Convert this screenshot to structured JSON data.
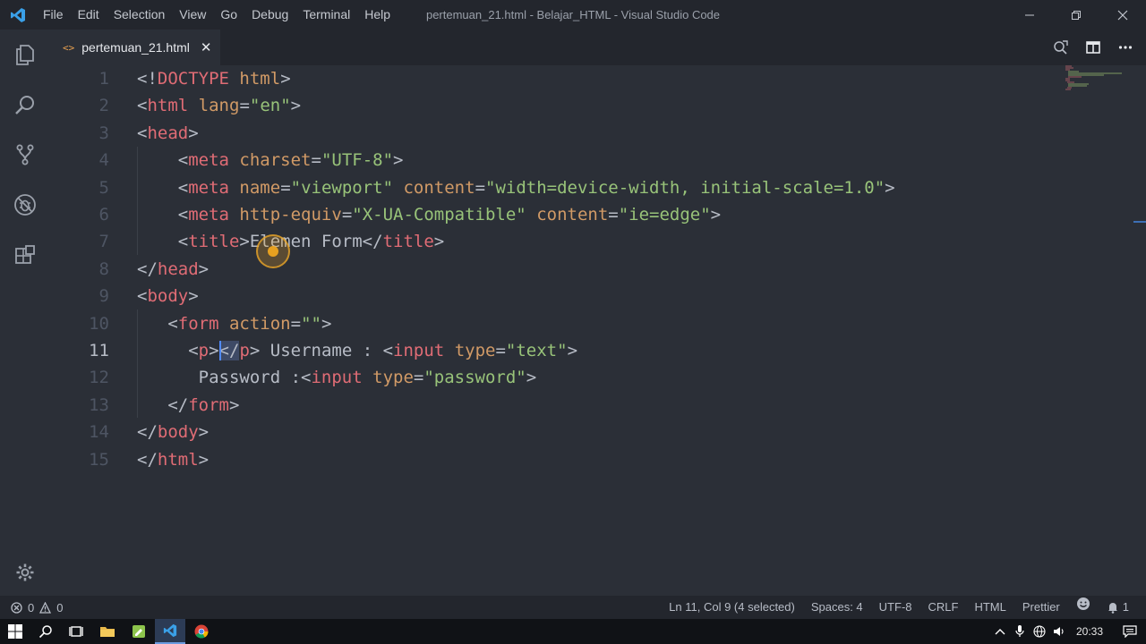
{
  "titlebar": {
    "menu": [
      "File",
      "Edit",
      "Selection",
      "View",
      "Go",
      "Debug",
      "Terminal",
      "Help"
    ],
    "title": "pertemuan_21.html - Belajar_HTML - Visual Studio Code"
  },
  "tab": {
    "icon_text": "<>",
    "label": "pertemuan_21.html",
    "close": "✕"
  },
  "editor": {
    "line_numbers": [
      "1",
      "2",
      "3",
      "4",
      "5",
      "6",
      "7",
      "8",
      "9",
      "10",
      "11",
      "12",
      "13",
      "14",
      "15"
    ],
    "active_line": 11,
    "lines": [
      [
        [
          "p",
          "<!"
        ],
        [
          "t",
          "DOCTYPE"
        ],
        [
          "p",
          " "
        ],
        [
          "a",
          "html"
        ],
        [
          "p",
          ">"
        ]
      ],
      [
        [
          "p",
          "<"
        ],
        [
          "t",
          "html"
        ],
        [
          "p",
          " "
        ],
        [
          "a",
          "lang"
        ],
        [
          "p",
          "="
        ],
        [
          "s",
          "\"en\""
        ],
        [
          "p",
          ">"
        ]
      ],
      [
        [
          "p",
          "<"
        ],
        [
          "t",
          "head"
        ],
        [
          "p",
          ">"
        ]
      ],
      [
        [
          "p",
          "    <"
        ],
        [
          "t",
          "meta"
        ],
        [
          "p",
          " "
        ],
        [
          "a",
          "charset"
        ],
        [
          "p",
          "="
        ],
        [
          "s",
          "\"UTF-8\""
        ],
        [
          "p",
          ">"
        ]
      ],
      [
        [
          "p",
          "    <"
        ],
        [
          "t",
          "meta"
        ],
        [
          "p",
          " "
        ],
        [
          "a",
          "name"
        ],
        [
          "p",
          "="
        ],
        [
          "s",
          "\"viewport\""
        ],
        [
          "p",
          " "
        ],
        [
          "a",
          "content"
        ],
        [
          "p",
          "="
        ],
        [
          "s",
          "\"width=device-width, initial-scale=1.0\""
        ],
        [
          "p",
          ">"
        ]
      ],
      [
        [
          "p",
          "    <"
        ],
        [
          "t",
          "meta"
        ],
        [
          "p",
          " "
        ],
        [
          "a",
          "http-equiv"
        ],
        [
          "p",
          "="
        ],
        [
          "s",
          "\"X-UA-Compatible\""
        ],
        [
          "p",
          " "
        ],
        [
          "a",
          "content"
        ],
        [
          "p",
          "="
        ],
        [
          "s",
          "\"ie=edge\""
        ],
        [
          "p",
          ">"
        ]
      ],
      [
        [
          "p",
          "    <"
        ],
        [
          "t",
          "title"
        ],
        [
          "p",
          ">Elemen Form</"
        ],
        [
          "t",
          "title"
        ],
        [
          "p",
          ">"
        ]
      ],
      [
        [
          "p",
          "</"
        ],
        [
          "t",
          "head"
        ],
        [
          "p",
          ">"
        ]
      ],
      [
        [
          "p",
          "<"
        ],
        [
          "t",
          "body"
        ],
        [
          "p",
          ">"
        ]
      ],
      [
        [
          "p",
          "   <"
        ],
        [
          "t",
          "form"
        ],
        [
          "p",
          " "
        ],
        [
          "a",
          "action"
        ],
        [
          "p",
          "="
        ],
        [
          "s",
          "\"\""
        ],
        [
          "p",
          ">"
        ]
      ],
      [
        [
          "p",
          "     <"
        ],
        [
          "t",
          "p"
        ],
        [
          "p",
          ">"
        ],
        [
          "sel",
          "</"
        ],
        [
          "t",
          "p"
        ],
        [
          "p",
          "> Username : <"
        ],
        [
          "t",
          "input"
        ],
        [
          "p",
          " "
        ],
        [
          "a",
          "type"
        ],
        [
          "p",
          "="
        ],
        [
          "s",
          "\"text\""
        ],
        [
          "p",
          ">"
        ]
      ],
      [
        [
          "p",
          "      Password :<"
        ],
        [
          "t",
          "input"
        ],
        [
          "p",
          " "
        ],
        [
          "a",
          "type"
        ],
        [
          "p",
          "="
        ],
        [
          "s",
          "\"password\""
        ],
        [
          "p",
          ">"
        ]
      ],
      [
        [
          "p",
          "   </"
        ],
        [
          "t",
          "form"
        ],
        [
          "p",
          ">"
        ]
      ],
      [
        [
          "p",
          "</"
        ],
        [
          "t",
          "body"
        ],
        [
          "p",
          ">"
        ]
      ],
      [
        [
          "p",
          "</"
        ],
        [
          "t",
          "html"
        ],
        [
          "p",
          ">"
        ]
      ]
    ]
  },
  "status": {
    "errors": "0",
    "warnings": "0",
    "position": "Ln 11, Col 9 (4 selected)",
    "spaces": "Spaces: 4",
    "encoding": "UTF-8",
    "eol": "CRLF",
    "language": "HTML",
    "formatter": "Prettier",
    "notifications": "1"
  },
  "taskbar": {
    "time": "20:33"
  },
  "colors": {
    "tag": "#e06c75",
    "attribute": "#d19a66",
    "string": "#98c379",
    "punctuation": "#b7bcc6",
    "accent": "#528bff"
  },
  "icons": {
    "activity": [
      "explorer-icon",
      "search-icon",
      "source-control-icon",
      "debug-icon",
      "extensions-icon"
    ],
    "settings": "gear-icon"
  }
}
